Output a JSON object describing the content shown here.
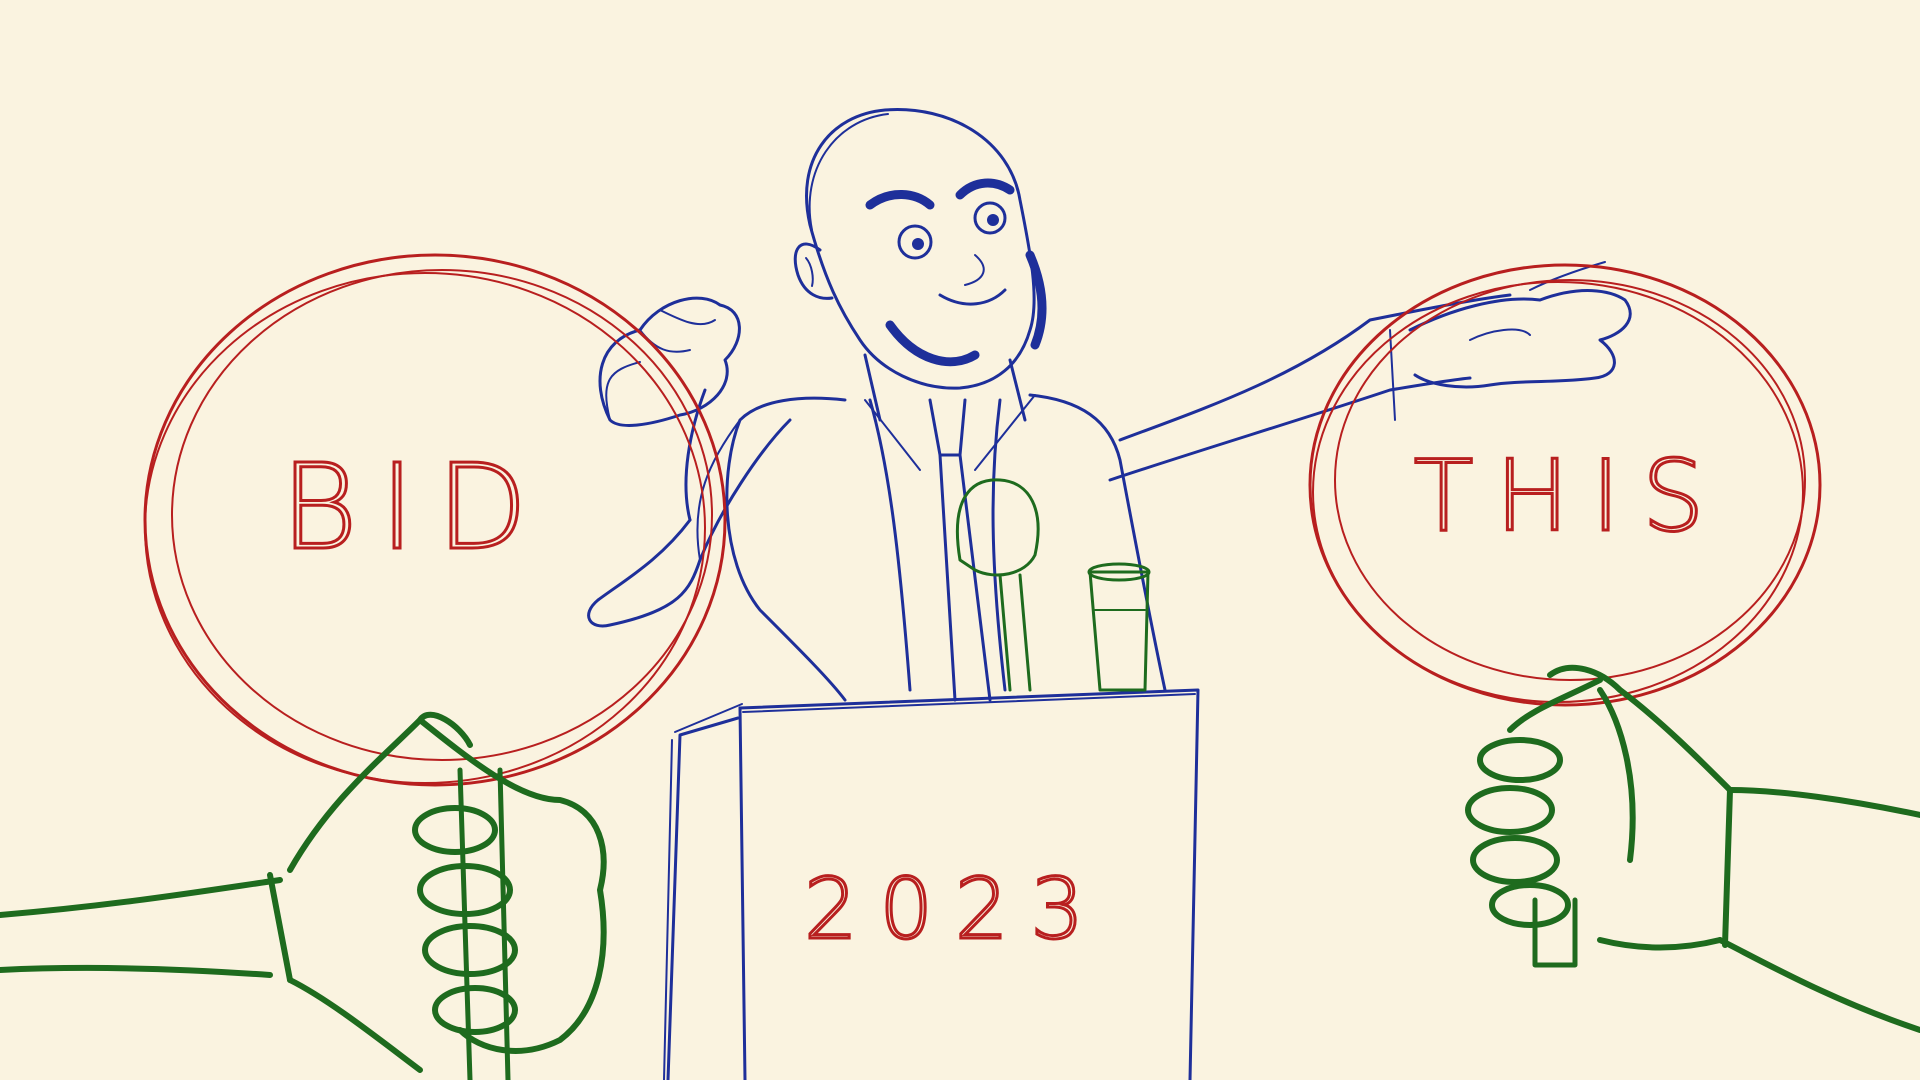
{
  "scene": {
    "background": "#faf3e0",
    "colors": {
      "ink_blue": "#1e2f9a",
      "ink_red": "#b81f1f",
      "ink_green": "#1e6b1e"
    },
    "left_paddle_text": "BID",
    "right_paddle_text": "THIS",
    "podium_text": "2023"
  }
}
